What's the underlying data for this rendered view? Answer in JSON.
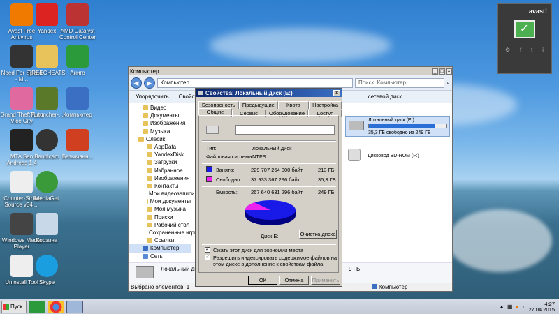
{
  "desktop": {
    "icons": [
      {
        "label": "Avast Free Antivirus"
      },
      {
        "label": "Yandex"
      },
      {
        "label": "AMD Catalyst Control Center"
      },
      {
        "label": "Need For Speed - M..."
      },
      {
        "label": "FREECHEATS"
      },
      {
        "label": "Аниго"
      },
      {
        "label": "Grand Theft Auto Vice City"
      },
      {
        "label": "TLauncher-..."
      },
      {
        "label": "Компьютер"
      },
      {
        "label": "MTA San Andreas 1.4"
      },
      {
        "label": "Bandicam"
      },
      {
        "label": "Безымянн..."
      },
      {
        "label": "Counter-Strike Source v34 ..."
      },
      {
        "label": "MediaGet"
      },
      {
        "label": "Windows Media Player"
      },
      {
        "label": "Корзина"
      },
      {
        "label": "Uninstall Tool"
      },
      {
        "label": "Skype"
      }
    ]
  },
  "explorer": {
    "title": "Компьютер",
    "address": "Компьютер",
    "search_placeholder": "Поиск: Компьютер",
    "toolbar": {
      "organize": "Упорядочить",
      "properties": "Свойства",
      "netdisk": "сетевой диск"
    },
    "nav": [
      "Видео",
      "Документы",
      "Изображения",
      "Музыка",
      "Олесик",
      "AppData",
      "YandexDisk",
      "Загрузки",
      "Избранное",
      "Изображения",
      "Контакты",
      "Мои видеозаписи",
      "Мои документы",
      "Моя музыка",
      "Поиски",
      "Рабочий стол",
      "Сохраненные игры",
      "Ссылки",
      "Компьютер",
      "Сеть"
    ],
    "drives": {
      "local_e": {
        "name": "Локальный диск (E:)",
        "free": "35,3 ГБ свободно из 249 ГБ",
        "used_fraction": 0.86
      },
      "bdrom": {
        "name": "Дисковод BD-ROM (F:)"
      }
    },
    "bottom_item": {
      "name": "Локальный диск",
      "size_frag": "9 ГБ",
      "computer_label": "Компьютер"
    },
    "status": "Выбрано элементов: 1"
  },
  "props": {
    "title": "Свойства: Локальный диск (E:)",
    "tabs_row1": [
      "Безопасность",
      "Предыдущие версии",
      "Квота",
      "Настройка"
    ],
    "tabs_row2": [
      "Общие",
      "Сервис",
      "Оборудование",
      "Доступ"
    ],
    "type_label": "Тип:",
    "type_value": "Локальный диск",
    "fs_label": "Файловая система:",
    "fs_value": "NTFS",
    "used_label": "Занято:",
    "used_bytes": "229 707 264 000 байт",
    "used_gb": "213 ГБ",
    "free_label": "Свободно:",
    "free_bytes": "37 933 367 296 байт",
    "free_gb": "35,3 ГБ",
    "cap_label": "Емкость:",
    "cap_bytes": "267 640 631 296 байт",
    "cap_gb": "249 ГБ",
    "disk_label": "Диск E:",
    "cleanup": "Очистка диска",
    "compress": "Сжать этот диск для экономии места",
    "index": "Разрешить индексировать содержимое файлов на этом диске в дополнение к свойствам файла",
    "ok": "ОК",
    "cancel": "Отмена",
    "apply": "Применить",
    "used_color": "#1a1ae8",
    "free_color": "#ee22ee"
  },
  "avast": {
    "brand": "avast!"
  },
  "taskbar": {
    "start": "Пуск",
    "time": "4:27",
    "date": "27.04.2015"
  }
}
